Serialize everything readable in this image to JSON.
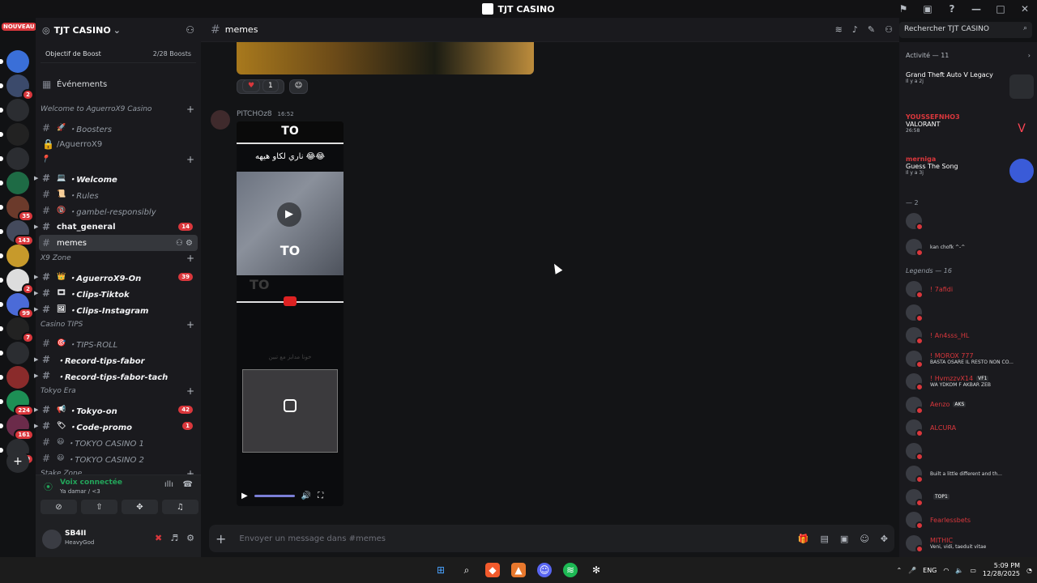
{
  "window": {
    "title": "TJT CASINO"
  },
  "server": {
    "name": "TJT CASINO",
    "boost_label": "Objectif de Boost",
    "boost_count": "2/28 Boosts",
    "events": "Événements"
  },
  "guilds": {
    "new_badge": "NOUVEAU",
    "badges": [
      "2",
      "35",
      "143",
      "2",
      "99",
      "7",
      "224",
      "161",
      "329"
    ]
  },
  "channels": [
    {
      "type": "cat",
      "label": "Welcome to AguerroX9 Casino"
    },
    {
      "type": "ch",
      "label": "・Boosters",
      "emoji": "🚀"
    },
    {
      "type": "ch",
      "label": "/AguerroX9",
      "lock": true
    },
    {
      "type": "cat",
      "label": "📍"
    },
    {
      "type": "ch",
      "label": "・Welcome",
      "emoji": "💻",
      "bold": true
    },
    {
      "type": "ch",
      "label": "・Rules",
      "emoji": "📜"
    },
    {
      "type": "ch",
      "label": "・gambel-responsibly",
      "emoji": "🔞"
    },
    {
      "type": "ch",
      "label": "chat_general",
      "badge": "14",
      "bold": true
    },
    {
      "type": "ch",
      "label": "memes",
      "selected": true
    },
    {
      "type": "cat",
      "label": "X9 Zone"
    },
    {
      "type": "ch",
      "label": "・AguerroX9-On",
      "emoji": "👑",
      "badge": "39",
      "bold": true
    },
    {
      "type": "ch",
      "label": "・Clips-Tiktok",
      "emoji": "🎞",
      "bold": true
    },
    {
      "type": "ch",
      "label": "・Clips-Instagram",
      "emoji": "🖼",
      "bold": true
    },
    {
      "type": "cat",
      "label": "Casino TIPS"
    },
    {
      "type": "ch",
      "label": "・TIPS-ROLL",
      "emoji": "🎯"
    },
    {
      "type": "ch",
      "label": "・Record-tips-fabor",
      "bold": true
    },
    {
      "type": "ch",
      "label": "・Record-tips-fabor-tach",
      "bold": true
    },
    {
      "type": "cat",
      "label": "Tokyo Era"
    },
    {
      "type": "ch",
      "label": "・Tokyo-on",
      "emoji": "📢",
      "badge": "42",
      "bold": true
    },
    {
      "type": "ch",
      "label": "・Code-promo",
      "emoji": "🏷",
      "badge": "1",
      "bold": true
    },
    {
      "type": "ch",
      "label": "・TOKYO CASINO 1",
      "emoji": "😃"
    },
    {
      "type": "ch",
      "label": "・TOKYO CASINO 2",
      "emoji": "😃"
    },
    {
      "type": "cat",
      "label": "Stake Zone"
    }
  ],
  "voice": {
    "status": "Voix connectée",
    "channel": "Ya damar / <3"
  },
  "user": {
    "name": "SB4II",
    "status": "HeavyGod"
  },
  "chat": {
    "channel": "memes",
    "reaction_count": "1",
    "author": "PITCHOz8",
    "time": "16:52",
    "video_top": "TO",
    "video_arabic": "ناري لكاو هيهه 😂😂",
    "video_to": "TO",
    "video_arabic2": "خونا مدابز مع تبين",
    "placeholder": "Envoyer un message dans #memes"
  },
  "search": {
    "placeholder": "Rechercher TJT CASINO"
  },
  "members": {
    "activity_header": "Activité — 11",
    "activities": [
      {
        "name": "",
        "game": "Grand Theft Auto V Legacy",
        "sub": "Il y a 2j"
      },
      {
        "name": "YOUSSEFNHO3",
        "game": "VALORANT",
        "sub": "26:58"
      },
      {
        "name": "merniga",
        "game": "Guess The Song",
        "sub": "Il y a 3j"
      }
    ],
    "group1": "— 2",
    "group1_members": [
      {
        "name": "",
        "sub": ""
      },
      {
        "name": "",
        "sub": "kan chofk ^-^"
      }
    ],
    "legends_header": "Legends — 16",
    "legends": [
      {
        "name": "! 7afidi",
        "sub": ""
      },
      {
        "name": "",
        "sub": ""
      },
      {
        "name": "! An4sss_HL",
        "sub": ""
      },
      {
        "name": "! MOROX 777",
        "sub": "BASTA OSARE IL RESTO NON CO..."
      },
      {
        "name": "! HvmzzvX14",
        "sub": "WA YDKOM F AKBAR ZEB",
        "tag": "VF1"
      },
      {
        "name": "Aenzo",
        "sub": "",
        "tag": "AKS"
      },
      {
        "name": "ALCURA",
        "sub": ""
      },
      {
        "name": "",
        "sub": ""
      },
      {
        "name": "",
        "sub": "Built a little different and th..."
      },
      {
        "name": "",
        "sub": "",
        "tag": "TOP1"
      },
      {
        "name": "Fearlessbets",
        "sub": ""
      },
      {
        "name": "MITHIC",
        "sub": "Veni, vidi, taeduit vitae"
      }
    ]
  },
  "taskbar": {
    "lang": "ENG",
    "time": "5:09 PM",
    "date": "12/28/2025"
  }
}
